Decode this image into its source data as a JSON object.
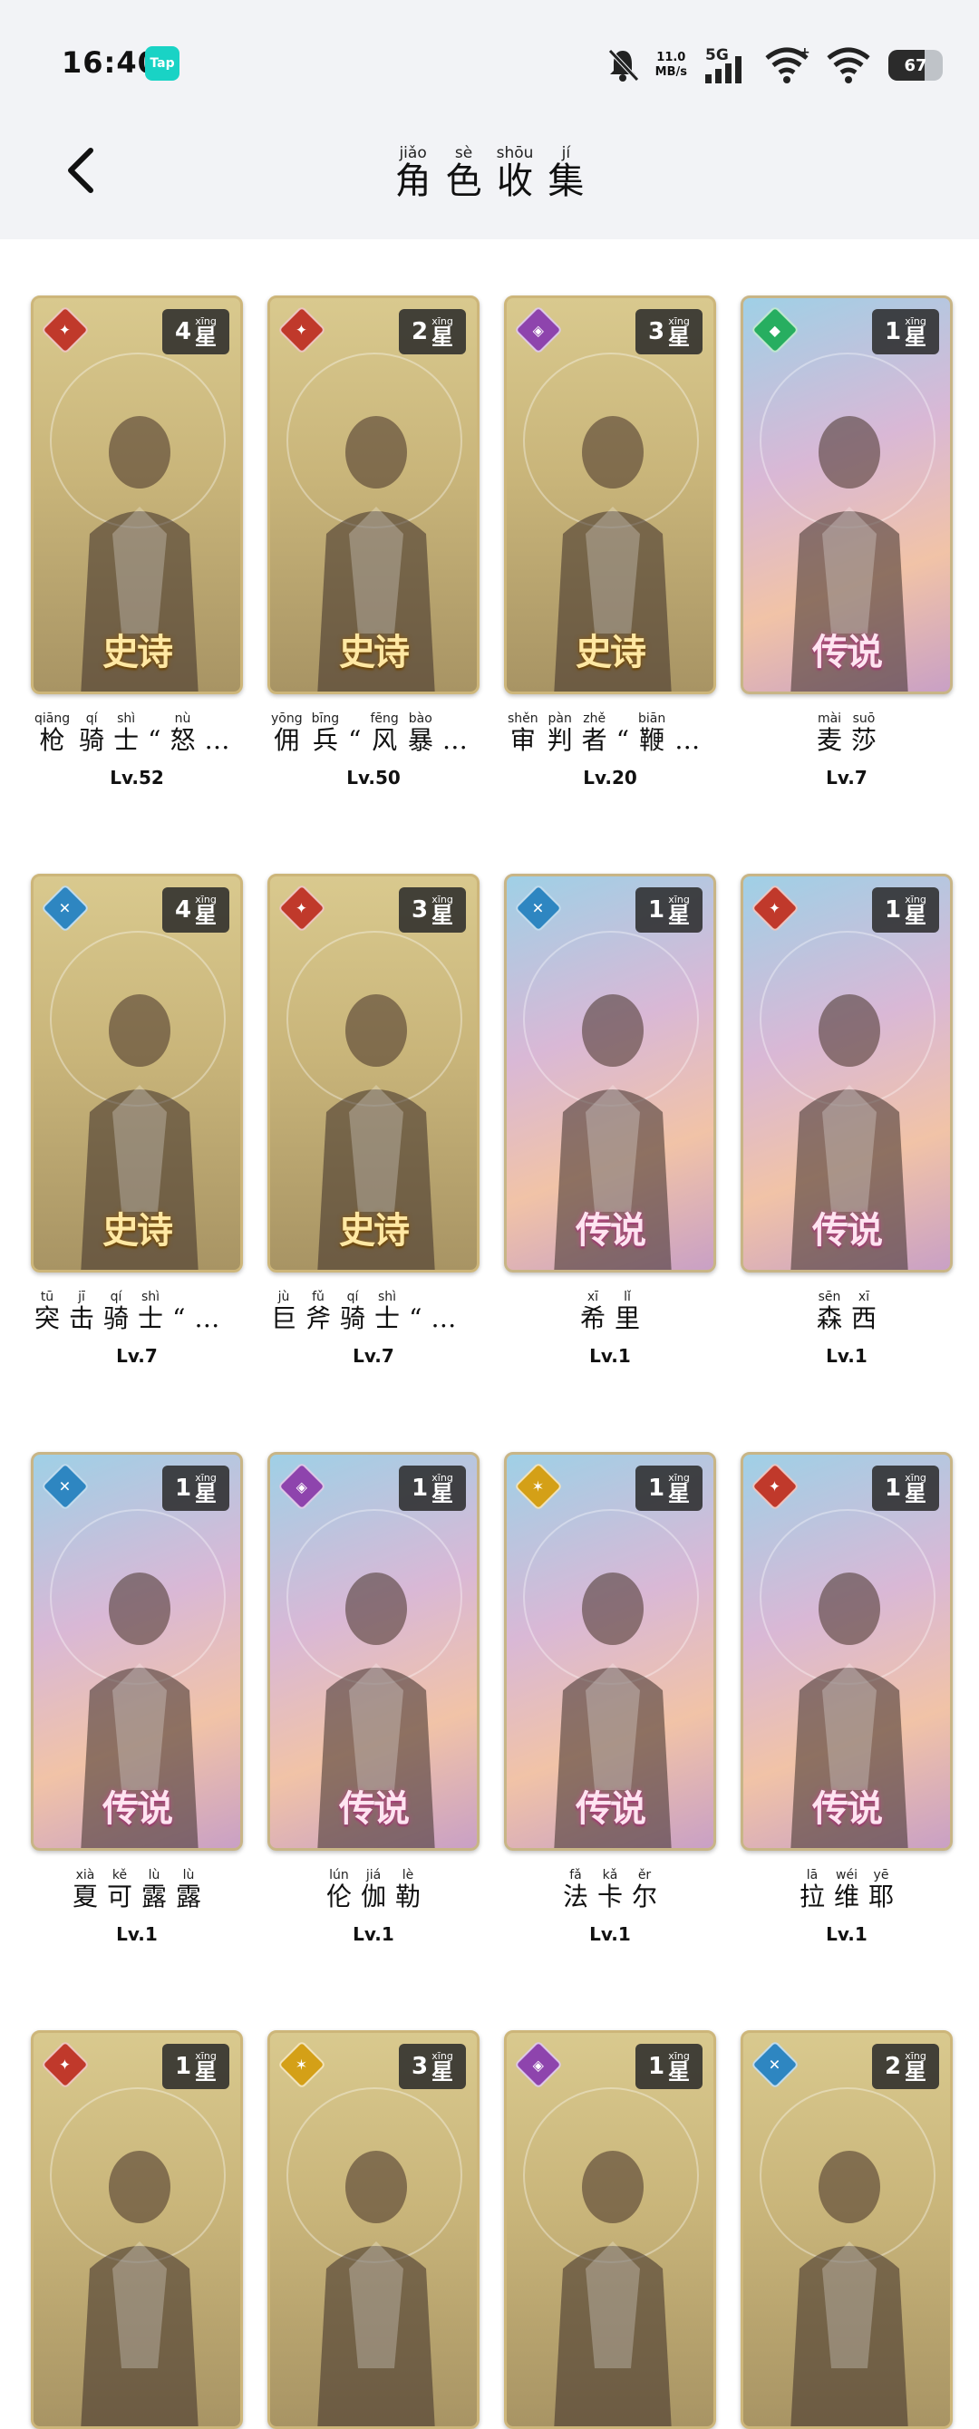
{
  "status_bar": {
    "time": "16:40",
    "tap_badge": "Tap",
    "network_speed_value": "11.0",
    "network_speed_unit": "MB/s",
    "network_type": "5G",
    "battery_level": "67"
  },
  "header": {
    "title_chars": [
      {
        "py": "jiǎo",
        "ch": "角"
      },
      {
        "py": "sè",
        "ch": "色"
      },
      {
        "py": "shōu",
        "ch": "收"
      },
      {
        "py": "jí",
        "ch": "集"
      }
    ]
  },
  "cards": [
    {
      "rarity": "史诗",
      "rarity_type": "epic",
      "stars": "4",
      "class_color": "#c0392b",
      "class_glyph": "✦",
      "level": "Lv.52",
      "name_chars": [
        {
          "py": "qiāng",
          "ch": "枪"
        },
        {
          "py": "qí",
          "ch": "骑"
        },
        {
          "py": "shì",
          "ch": "士"
        },
        {
          "py": "",
          "ch": "“"
        },
        {
          "py": "nù",
          "ch": "怒"
        },
        {
          "py": "",
          "ch": "…"
        }
      ]
    },
    {
      "rarity": "史诗",
      "rarity_type": "epic",
      "stars": "2",
      "class_color": "#c0392b",
      "class_glyph": "✦",
      "level": "Lv.50",
      "name_chars": [
        {
          "py": "yōng",
          "ch": "佣"
        },
        {
          "py": "bīng",
          "ch": "兵"
        },
        {
          "py": "",
          "ch": "“"
        },
        {
          "py": "fēng",
          "ch": "风"
        },
        {
          "py": "bào",
          "ch": "暴"
        },
        {
          "py": "",
          "ch": "…"
        }
      ]
    },
    {
      "rarity": "史诗",
      "rarity_type": "epic",
      "stars": "3",
      "class_color": "#8e44ad",
      "class_glyph": "◈",
      "level": "Lv.20",
      "name_chars": [
        {
          "py": "shěn",
          "ch": "审"
        },
        {
          "py": "pàn",
          "ch": "判"
        },
        {
          "py": "zhě",
          "ch": "者"
        },
        {
          "py": "",
          "ch": "“"
        },
        {
          "py": "biān",
          "ch": "鞭"
        },
        {
          "py": "",
          "ch": "…"
        }
      ]
    },
    {
      "rarity": "传说",
      "rarity_type": "legend",
      "stars": "1",
      "class_color": "#27ae60",
      "class_glyph": "◆",
      "level": "Lv.7",
      "name_chars": [
        {
          "py": "mài",
          "ch": "麦"
        },
        {
          "py": "suō",
          "ch": "莎"
        }
      ]
    },
    {
      "rarity": "史诗",
      "rarity_type": "epic",
      "stars": "4",
      "class_color": "#2e86c1",
      "class_glyph": "✕",
      "level": "Lv.7",
      "name_chars": [
        {
          "py": "tū",
          "ch": "突"
        },
        {
          "py": "jī",
          "ch": "击"
        },
        {
          "py": "qí",
          "ch": "骑"
        },
        {
          "py": "shì",
          "ch": "士"
        },
        {
          "py": "",
          "ch": "“"
        },
        {
          "py": "",
          "ch": "…"
        }
      ]
    },
    {
      "rarity": "史诗",
      "rarity_type": "epic",
      "stars": "3",
      "class_color": "#c0392b",
      "class_glyph": "✦",
      "level": "Lv.7",
      "name_chars": [
        {
          "py": "jù",
          "ch": "巨"
        },
        {
          "py": "fǔ",
          "ch": "斧"
        },
        {
          "py": "qí",
          "ch": "骑"
        },
        {
          "py": "shì",
          "ch": "士"
        },
        {
          "py": "",
          "ch": "“"
        },
        {
          "py": "",
          "ch": "…"
        }
      ]
    },
    {
      "rarity": "传说",
      "rarity_type": "legend",
      "stars": "1",
      "class_color": "#2e86c1",
      "class_glyph": "✕",
      "level": "Lv.1",
      "name_chars": [
        {
          "py": "xī",
          "ch": "希"
        },
        {
          "py": "lǐ",
          "ch": "里"
        }
      ]
    },
    {
      "rarity": "传说",
      "rarity_type": "legend",
      "stars": "1",
      "class_color": "#c0392b",
      "class_glyph": "✦",
      "level": "Lv.1",
      "name_chars": [
        {
          "py": "sēn",
          "ch": "森"
        },
        {
          "py": "xī",
          "ch": "西"
        }
      ]
    },
    {
      "rarity": "传说",
      "rarity_type": "legend",
      "stars": "1",
      "class_color": "#2e86c1",
      "class_glyph": "✕",
      "level": "Lv.1",
      "name_chars": [
        {
          "py": "xià",
          "ch": "夏"
        },
        {
          "py": "kě",
          "ch": "可"
        },
        {
          "py": "lù",
          "ch": "露"
        },
        {
          "py": "lù",
          "ch": "露"
        }
      ]
    },
    {
      "rarity": "传说",
      "rarity_type": "legend",
      "stars": "1",
      "class_color": "#8e44ad",
      "class_glyph": "◈",
      "level": "Lv.1",
      "name_chars": [
        {
          "py": "lún",
          "ch": "伦"
        },
        {
          "py": "jiá",
          "ch": "伽"
        },
        {
          "py": "lè",
          "ch": "勒"
        }
      ]
    },
    {
      "rarity": "传说",
      "rarity_type": "legend",
      "stars": "1",
      "class_color": "#d4a017",
      "class_glyph": "✶",
      "level": "Lv.1",
      "name_chars": [
        {
          "py": "fǎ",
          "ch": "法"
        },
        {
          "py": "kǎ",
          "ch": "卡"
        },
        {
          "py": "ěr",
          "ch": "尔"
        }
      ]
    },
    {
      "rarity": "传说",
      "rarity_type": "legend",
      "stars": "1",
      "class_color": "#c0392b",
      "class_glyph": "✦",
      "level": "Lv.1",
      "name_chars": [
        {
          "py": "lā",
          "ch": "拉"
        },
        {
          "py": "wéi",
          "ch": "维"
        },
        {
          "py": "yē",
          "ch": "耶"
        }
      ]
    },
    {
      "rarity": "",
      "rarity_type": "epic",
      "stars": "1",
      "class_color": "#c0392b",
      "class_glyph": "✦",
      "level": "",
      "name_chars": []
    },
    {
      "rarity": "",
      "rarity_type": "epic",
      "stars": "3",
      "class_color": "#d4a017",
      "class_glyph": "✶",
      "level": "",
      "name_chars": []
    },
    {
      "rarity": "",
      "rarity_type": "epic",
      "stars": "1",
      "class_color": "#8e44ad",
      "class_glyph": "◈",
      "level": "",
      "name_chars": []
    },
    {
      "rarity": "",
      "rarity_type": "epic",
      "stars": "2",
      "class_color": "#2e86c1",
      "class_glyph": "✕",
      "level": "",
      "name_chars": []
    }
  ],
  "star_label": {
    "py": "xīng",
    "ch": "星"
  }
}
